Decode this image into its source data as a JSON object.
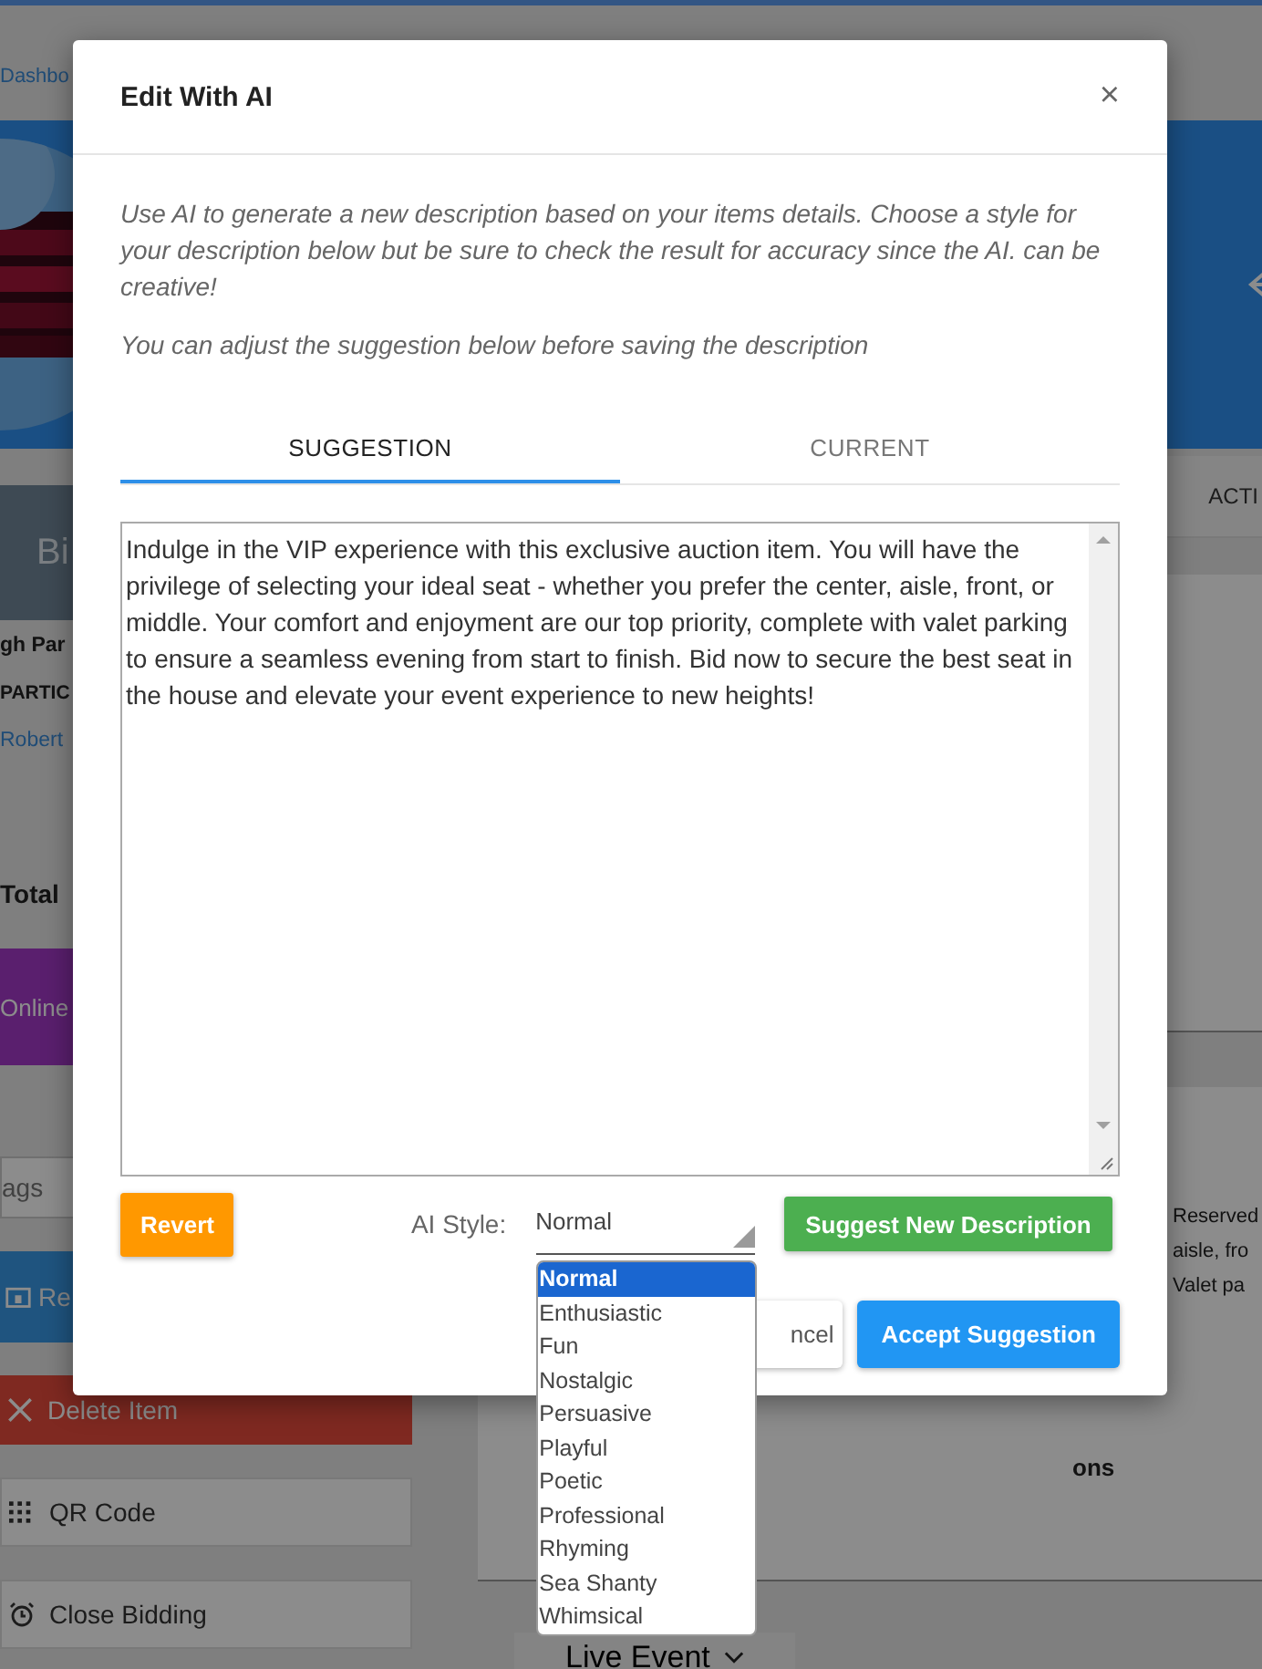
{
  "background": {
    "breadcrumb": "Dashbo",
    "header_label": "Bi",
    "item_title": "gh Par",
    "section_label": "PARTIC",
    "bidder_link": "Robert",
    "total_label": "Total",
    "status_banner": "Online",
    "tags_placeholder": "ags",
    "primary_button": "Re",
    "buttons": [
      {
        "label": "Delete Item",
        "kind": "danger"
      },
      {
        "label": "QR Code",
        "kind": "qr"
      },
      {
        "label": "Close Bidding",
        "kind": "close"
      }
    ],
    "tab_label": "ACTI",
    "description_lines": [
      "Reserved",
      "aisle, fro",
      "Valet pa"
    ],
    "section_heading": "ons",
    "event_dropdown": "Live Event"
  },
  "dialog": {
    "title": "Edit With AI",
    "close": "×",
    "intro": [
      "Use AI to generate a new description based on your items details. Choose a style for your description below but be sure to check the result for accuracy since the AI. can be creative!",
      "You can adjust the suggestion below before saving the description"
    ],
    "tabs": [
      {
        "label": "SUGGESTION",
        "selected": true
      },
      {
        "label": "CURRENT",
        "selected": false
      }
    ],
    "suggestion": "Indulge in the VIP experience with this exclusive auction item. You will have the privilege of selecting your ideal seat - whether you prefer the center, aisle, front, or middle. Your comfort and enjoyment are our top priority, complete with valet parking to ensure a seamless evening from start to finish. Bid now to secure the best seat in the house and elevate your event experience to new heights!",
    "revert_button": "Revert",
    "style_label": "AI Style:",
    "style_select": {
      "value": "Normal",
      "expanded": true,
      "options": [
        {
          "label": "Normal",
          "selected": true
        },
        {
          "label": "Enthusiastic",
          "selected": false
        },
        {
          "label": "Fun",
          "selected": false
        },
        {
          "label": "Nostalgic",
          "selected": false
        },
        {
          "label": "Persuasive",
          "selected": false
        },
        {
          "label": "Playful",
          "selected": false
        },
        {
          "label": "Poetic",
          "selected": false
        },
        {
          "label": "Professional",
          "selected": false
        },
        {
          "label": "Rhyming",
          "selected": false
        },
        {
          "label": "Sea Shanty",
          "selected": false
        },
        {
          "label": "Whimsical",
          "selected": false
        }
      ]
    },
    "suggest_button": "Suggest New Description",
    "cancel_button": "ncel",
    "accept_button": "Accept Suggestion"
  }
}
